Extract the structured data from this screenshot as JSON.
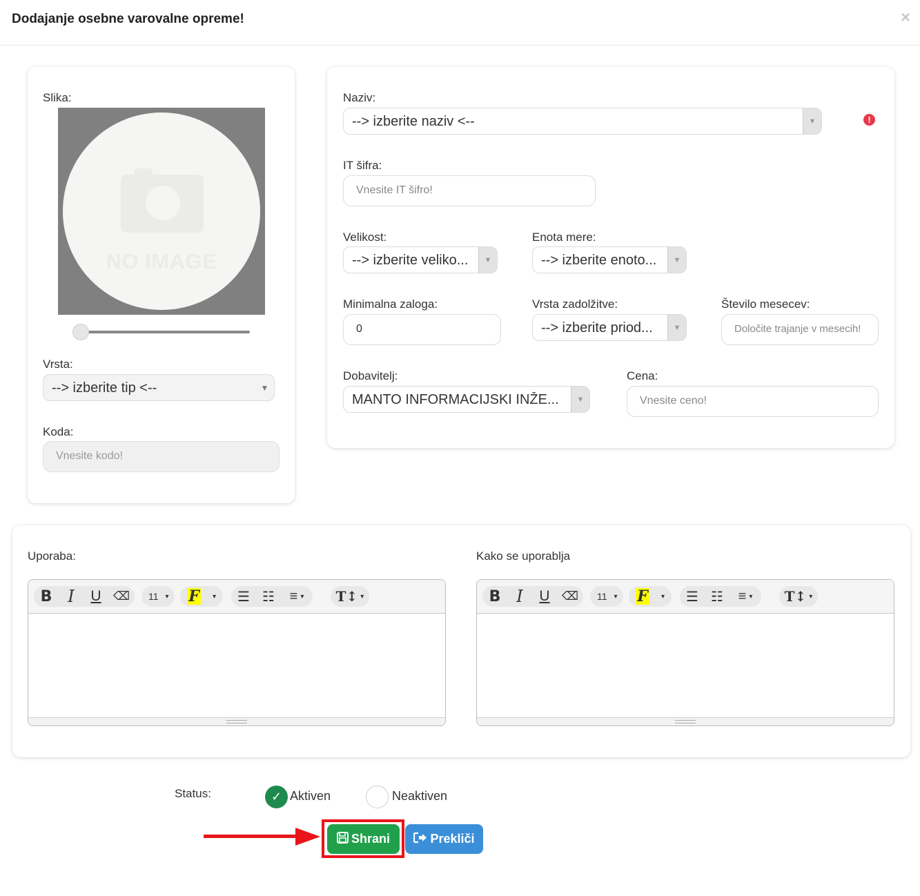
{
  "header": {
    "title": "Dodajanje osebne varovalne opreme!",
    "close": "×"
  },
  "left": {
    "image_label": "Slika:",
    "no_image_text": "NO IMAGE",
    "zoom_level": 0,
    "type_label": "Vrsta:",
    "type_value": "--> izberite tip <--",
    "code_label": "Koda:",
    "code_placeholder": "Vnesite kodo!"
  },
  "right": {
    "name_label": "Naziv:",
    "name_value": "--> izberite naziv <--",
    "warning": "!",
    "it_label": "IT šifra:",
    "it_placeholder": "Vnesite IT šifro!",
    "size_label": "Velikost:",
    "size_value": "--> izberite veliko...",
    "unit_label": "Enota mere:",
    "unit_value": "--> izberite enoto...",
    "minstock_label": "Minimalna zaloga:",
    "minstock_value": "0",
    "assign_label": "Vrsta zadolžitve:",
    "assign_value": "--> izberite priod...",
    "months_label": "Število mesecev:",
    "months_placeholder": "Določite trajanje v mesecih!",
    "supplier_label": "Dobavitelj:",
    "supplier_value": "MANTO INFORMACIJSKI INŽE...",
    "price_label": "Cena:",
    "price_placeholder": "Vnesite ceno!"
  },
  "editors": {
    "usage_label": "Uporaba:",
    "howto_label": "Kako se uporablja",
    "toolbar": {
      "bold": "B",
      "italic": "I",
      "underline": "U",
      "eraser": "⌫",
      "font_size": "11",
      "font_color": "F",
      "caret": "▾",
      "bullet": "☰",
      "numbered": "☷",
      "align": "≡",
      "line_height": "T↕"
    }
  },
  "status": {
    "label": "Status:",
    "active_label": "Aktiven",
    "inactive_label": "Neaktiven",
    "selected": "Aktiven"
  },
  "actions": {
    "save_label": "Shrani",
    "cancel_label": "Prekliči"
  },
  "colors": {
    "save": "#21a04b",
    "cancel": "#3b8fd9",
    "active_radio": "#1f8a4e",
    "annotation": "#e8141a",
    "warning": "#e8394a"
  }
}
